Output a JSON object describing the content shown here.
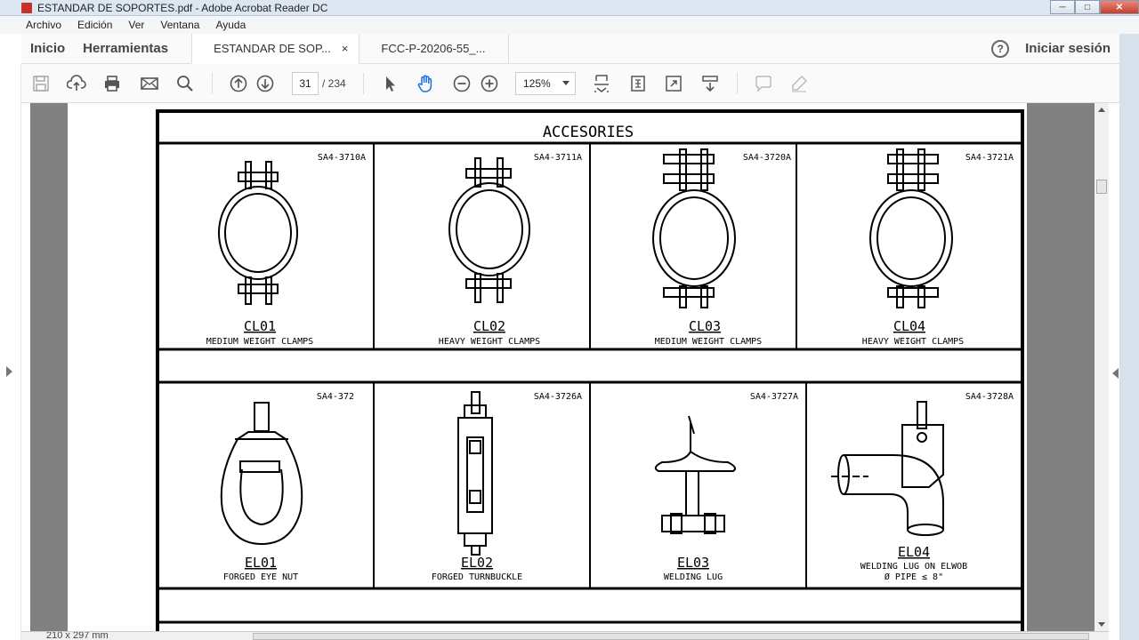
{
  "window": {
    "title": "ESTANDAR DE SOPORTES.pdf - Adobe Acrobat Reader DC",
    "minimize": "─",
    "maximize": "□",
    "close": "✕"
  },
  "menu": [
    "Archivo",
    "Edición",
    "Ver",
    "Ventana",
    "Ayuda"
  ],
  "nav": {
    "home": "Inicio",
    "tools": "Herramientas",
    "tabs": [
      {
        "label": "ESTANDAR DE SOP...",
        "close": "×"
      },
      {
        "label": "FCC-P-20206-55_..."
      }
    ],
    "help": "?",
    "signin": "Iniciar sesión"
  },
  "toolbar": {
    "icons": [
      "save-icon",
      "upload-icon",
      "print-icon",
      "email-icon",
      "search-icon",
      "page-up-icon",
      "page-down-icon",
      "select-arrow-icon",
      "hand-tool-icon",
      "zoom-out-icon",
      "zoom-in-icon",
      "fit-page-icon",
      "scroll-mode-icon",
      "fullscreen-icon",
      "read-mode-icon",
      "comment-icon",
      "highlight-icon"
    ],
    "page_current": "31",
    "page_total": "/ 234",
    "zoom": "125%"
  },
  "status": {
    "page_size": "210 x 297 mm"
  },
  "sheet": {
    "header": "ACCESORIES",
    "row1": [
      {
        "ref": "SA4-3710A",
        "code": "CL01",
        "desc": "MEDIUM WEIGHT CLAMPS"
      },
      {
        "ref": "SA4-3711A",
        "code": "CL02",
        "desc": "HEAVY WEIGHT CLAMPS"
      },
      {
        "ref": "SA4-3720A",
        "code": "CL03",
        "desc": "MEDIUM WEIGHT CLAMPS"
      },
      {
        "ref": "SA4-3721A",
        "code": "CL04",
        "desc": "HEAVY WEIGHT CLAMPS"
      }
    ],
    "row2": [
      {
        "ref": "SA4-372",
        "code": "EL01",
        "desc": "FORGED EYE NUT"
      },
      {
        "ref": "SA4-3726A",
        "code": "EL02",
        "desc": "FORGED TURNBUCKLE"
      },
      {
        "ref": "SA4-3727A",
        "code": "EL03",
        "desc": "WELDING LUG"
      },
      {
        "ref": "SA4-3728A",
        "code": "EL04",
        "desc": "WELDING LUG ON ELWOB",
        "desc2": "Ø PIPE ≤ 8\""
      }
    ]
  },
  "colors": {
    "accent": "#1473e6",
    "viewport_bg": "#808080"
  }
}
